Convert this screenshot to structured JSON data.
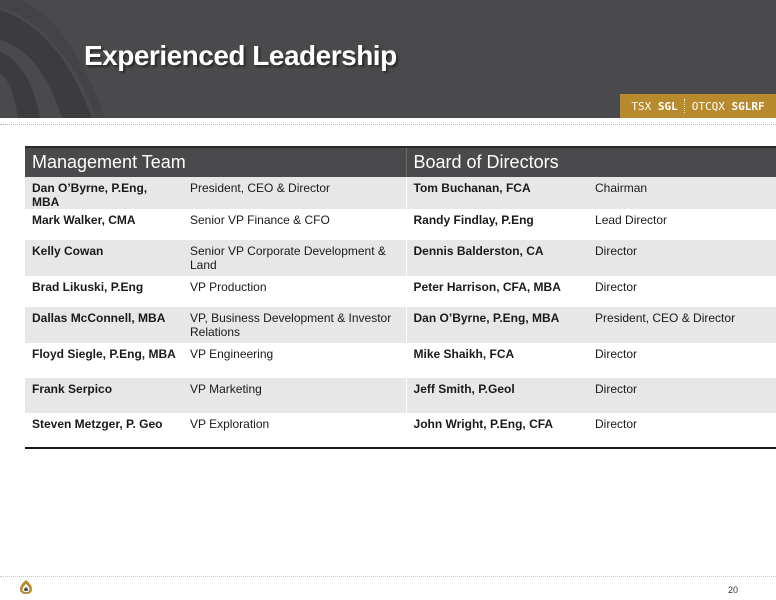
{
  "header": {
    "title": "Experienced Leadership",
    "ticker": {
      "exchange1": "TSX",
      "symbol1": "SGL",
      "exchange2": "OTCQX",
      "symbol2": "SGLRF"
    }
  },
  "table": {
    "left_header": "Management Team",
    "right_header": "Board of Directors",
    "rows": [
      {
        "m_name": "Dan O’Byrne, P.Eng, MBA",
        "m_role": "President, CEO & Director",
        "b_name": "Tom Buchanan, FCA",
        "b_role": "Chairman"
      },
      {
        "m_name": "Mark Walker, CMA",
        "m_role": "Senior VP Finance & CFO",
        "b_name": "Randy Findlay, P.Eng",
        "b_role": "Lead Director"
      },
      {
        "m_name": "Kelly Cowan",
        "m_role": "Senior VP Corporate Development & Land",
        "b_name": "Dennis Balderston, CA",
        "b_role": "Director"
      },
      {
        "m_name": "Brad Likuski, P.Eng",
        "m_role": "VP Production",
        "b_name": "Peter Harrison, CFA, MBA",
        "b_role": "Director"
      },
      {
        "m_name": "Dallas McConnell, MBA",
        "m_role": "VP, Business Development & Investor Relations",
        "b_name": "Dan O’Byrne, P.Eng, MBA",
        "b_role": "President, CEO & Director"
      },
      {
        "m_name": "Floyd Siegle, P.Eng, MBA",
        "m_role": "VP Engineering",
        "b_name": "Mike Shaikh, FCA",
        "b_role": "Director"
      },
      {
        "m_name": "Frank Serpico",
        "m_role": "VP Marketing",
        "b_name": "Jeff Smith, P.Geol",
        "b_role": "Director"
      },
      {
        "m_name": "Steven Metzger, P. Geo",
        "m_role": "VP Exploration",
        "b_name": "John Wright, P.Eng, CFA",
        "b_role": "Director"
      }
    ]
  },
  "footer": {
    "page_number": "20"
  },
  "colors": {
    "header_bg": "#4a4a4c",
    "accent_gold": "#b88a2e",
    "row_shade": "#e7e7e7"
  },
  "icons": {
    "header_logo": "company-flame-logo-icon",
    "footer_logo": "company-flame-logo-icon"
  }
}
